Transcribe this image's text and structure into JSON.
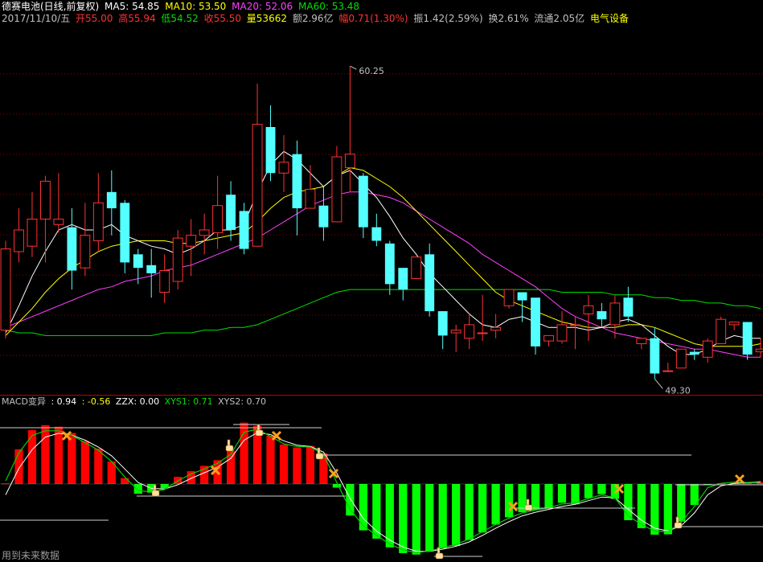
{
  "header": {
    "title": "德赛电池(日线,前复权)",
    "ma5": "MA5: 54.85",
    "ma10": "MA10: 53.50",
    "ma20": "MA20: 52.06",
    "ma60": "MA60: 53.48"
  },
  "quote": {
    "date": "2017/11/10/五",
    "open": "开55.00",
    "high": "高55.94",
    "low": "低54.52",
    "close": "收55.50",
    "volume": "量53662",
    "amount": "额2.96亿",
    "change": "幅0.71(1.30%)",
    "amplitude": "振1.42(2.59%)",
    "turnover": "换2.61%",
    "float": "流通2.05亿",
    "sector": "电气设备"
  },
  "macd_header": {
    "name": "MACD变异",
    "v1": ": 0.94",
    "v2": ": -0.56",
    "zzx": "ZZX: 0.00",
    "xys1": "XYS1: 0.71",
    "xys2": "XYS2: 0.70"
  },
  "footer": "用到未来数据",
  "colors": {
    "up": "#ff3232",
    "down": "#54ffff",
    "ma5": "#ffffff",
    "ma10": "#ffff00",
    "ma20": "#ff40ff",
    "ma60": "#00e000",
    "hist_up": "#ff0000",
    "hist_down": "#00ff00",
    "grid": "#990000"
  },
  "chart_data": [
    {
      "type": "candlestick",
      "high_label": "60.25",
      "low_label": "49.30",
      "ylim": [
        48.5,
        61.8
      ],
      "candles": [
        [
          50.5,
          53.5,
          50.2,
          53.8
        ],
        [
          53.4,
          54.2,
          53.0,
          55.0
        ],
        [
          53.6,
          54.6,
          53.2,
          55.6
        ],
        [
          54.6,
          56.0,
          53.0,
          56.2
        ],
        [
          54.4,
          54.6,
          54.1,
          56.3
        ],
        [
          54.3,
          52.7,
          52.0,
          55.0
        ],
        [
          52.8,
          54.0,
          52.5,
          55.2
        ],
        [
          53.8,
          55.2,
          53.4,
          56.3
        ],
        [
          55.6,
          55.0,
          54.0,
          56.4
        ],
        [
          55.2,
          53.0,
          52.6,
          55.3
        ],
        [
          53.3,
          52.8,
          52.2,
          53.5
        ],
        [
          52.9,
          52.6,
          51.7,
          53.5
        ],
        [
          51.9,
          52.7,
          51.5,
          53.3
        ],
        [
          52.3,
          53.9,
          52.0,
          54.2
        ],
        [
          53.6,
          54.0,
          52.5,
          54.6
        ],
        [
          54.0,
          54.2,
          53.3,
          54.8
        ],
        [
          54.1,
          55.1,
          53.5,
          56.2
        ],
        [
          55.5,
          54.2,
          53.8,
          56.0
        ],
        [
          54.9,
          53.5,
          53.3,
          55.2
        ],
        [
          53.6,
          58.1,
          53.6,
          59.6
        ],
        [
          58.0,
          56.3,
          56.0,
          58.8
        ],
        [
          56.3,
          56.7,
          55.6,
          57.7
        ],
        [
          57.0,
          55.0,
          54.0,
          57.5
        ],
        [
          55.0,
          55.7,
          55.0,
          56.6
        ],
        [
          55.1,
          54.3,
          53.8,
          55.8
        ],
        [
          54.5,
          56.9,
          54.5,
          57.3
        ],
        [
          56.5,
          57.0,
          55.6,
          60.25
        ],
        [
          56.2,
          54.3,
          53.9,
          56.3
        ],
        [
          54.3,
          53.8,
          53.6,
          54.8
        ],
        [
          53.7,
          52.2,
          51.8,
          53.8
        ],
        [
          52.8,
          52.0,
          51.6,
          52.5
        ],
        [
          52.4,
          53.2,
          52.4,
          53.2
        ],
        [
          53.3,
          51.2,
          51.0,
          53.7
        ],
        [
          51.2,
          50.3,
          49.8,
          51.2
        ],
        [
          50.4,
          50.5,
          49.7,
          50.7
        ],
        [
          50.2,
          50.7,
          49.8,
          51.1
        ],
        [
          50.4,
          50.4,
          50.1,
          51.8
        ],
        [
          50.5,
          50.6,
          50.2,
          51.1
        ],
        [
          51.4,
          52.0,
          51.3,
          51.8
        ],
        [
          51.9,
          51.6,
          50.8,
          51.7
        ],
        [
          51.7,
          49.9,
          49.6,
          51.6
        ],
        [
          50.1,
          50.3,
          49.9,
          50.3
        ],
        [
          50.1,
          50.7,
          50.0,
          51.2
        ],
        [
          50.7,
          50.7,
          49.8,
          51.0
        ],
        [
          51.1,
          51.4,
          50.1,
          51.8
        ],
        [
          51.2,
          50.9,
          50.6,
          51.5
        ],
        [
          50.7,
          51.5,
          50.2,
          51.8
        ],
        [
          51.7,
          51.0,
          50.8,
          52.1
        ],
        [
          50.0,
          50.2,
          49.8,
          50.2
        ],
        [
          50.2,
          48.9,
          48.7,
          50.6
        ],
        [
          49.0,
          49.0,
          49.3,
          49.0
        ],
        [
          49.1,
          49.8,
          49.2,
          49.8
        ],
        [
          49.7,
          49.6,
          49.4,
          49.8
        ],
        [
          49.5,
          50.1,
          49.3,
          50.2
        ],
        [
          50.0,
          50.9,
          50.0,
          51.0
        ],
        [
          50.7,
          50.8,
          50.5,
          50.8
        ],
        [
          50.8,
          49.6,
          49.4,
          50.8
        ],
        [
          49.7,
          49.8,
          49.5,
          50.2
        ]
      ],
      "ma5": [
        50.4,
        51.4,
        52.5,
        53.4,
        54.2,
        54.4,
        54.2,
        54.2,
        54.4,
        54.0,
        53.8,
        53.6,
        53.5,
        53.3,
        53.5,
        53.8,
        54.2,
        54.2,
        54.4,
        55.6,
        56.6,
        57.1,
        56.8,
        56.3,
        55.8,
        56.2,
        56.4,
        55.9,
        55.4,
        54.7,
        53.9,
        53.3,
        52.6,
        52.1,
        51.6,
        51.1,
        50.7,
        50.6,
        50.9,
        51.0,
        50.8,
        50.6,
        50.6,
        50.6,
        50.5,
        50.6,
        50.8,
        50.9,
        50.7,
        50.3,
        49.9,
        49.6,
        49.6,
        49.8,
        50.1,
        50.3,
        50.2,
        50.2
      ],
      "ma10": [
        50.3,
        50.8,
        51.3,
        51.9,
        52.4,
        52.8,
        53.1,
        53.4,
        53.6,
        53.7,
        53.8,
        53.8,
        53.8,
        53.7,
        53.7,
        53.8,
        53.9,
        54.0,
        54.1,
        54.5,
        55.0,
        55.4,
        55.6,
        55.7,
        55.8,
        56.2,
        56.5,
        56.4,
        56.1,
        55.8,
        55.4,
        54.9,
        54.4,
        53.9,
        53.4,
        52.9,
        52.4,
        51.9,
        51.6,
        51.4,
        51.2,
        51.0,
        50.8,
        50.7,
        50.6,
        50.6,
        50.6,
        50.7,
        50.7,
        50.6,
        50.4,
        50.2,
        50.0,
        49.9,
        49.9,
        49.9,
        49.9,
        50.0
      ],
      "ma20": [
        50.6,
        50.8,
        51.0,
        51.2,
        51.4,
        51.6,
        51.8,
        52.0,
        52.1,
        52.3,
        52.4,
        52.5,
        52.7,
        52.8,
        52.9,
        53.1,
        53.3,
        53.5,
        53.7,
        53.9,
        54.2,
        54.5,
        54.8,
        55.1,
        55.3,
        55.5,
        55.6,
        55.6,
        55.5,
        55.4,
        55.2,
        54.9,
        54.6,
        54.3,
        54.0,
        53.7,
        53.3,
        53.0,
        52.7,
        52.4,
        52.1,
        51.7,
        51.3,
        51.0,
        50.8,
        50.6,
        50.4,
        50.3,
        50.2,
        50.1,
        50.0,
        49.9,
        49.8,
        49.8,
        49.7,
        49.6,
        49.5,
        49.5
      ],
      "ma60": [
        50.5,
        50.4,
        50.4,
        50.3,
        50.3,
        50.3,
        50.3,
        50.3,
        50.3,
        50.3,
        50.3,
        50.3,
        50.4,
        50.4,
        50.4,
        50.5,
        50.5,
        50.6,
        50.6,
        50.7,
        50.9,
        51.1,
        51.3,
        51.5,
        51.7,
        51.9,
        52.0,
        52.0,
        52.0,
        52.0,
        52.0,
        52.0,
        52.0,
        52.0,
        52.0,
        52.0,
        52.0,
        52.0,
        52.0,
        52.0,
        52.0,
        52.0,
        51.9,
        51.9,
        51.9,
        51.9,
        51.8,
        51.8,
        51.8,
        51.7,
        51.7,
        51.6,
        51.6,
        51.5,
        51.5,
        51.4,
        51.4,
        51.3
      ]
    },
    {
      "type": "bar",
      "title": "MACD变异",
      "ylim": [
        -2.0,
        1.9
      ],
      "values": [
        0.02,
        1.11,
        1.72,
        1.88,
        1.83,
        1.63,
        1.37,
        1.13,
        0.72,
        0.19,
        -0.27,
        -0.24,
        -0.12,
        0.23,
        0.41,
        0.58,
        0.76,
        1.06,
        1.96,
        1.86,
        1.54,
        1.26,
        1.17,
        1.22,
        0.98,
        -0.1,
        -0.87,
        -1.28,
        -1.51,
        -1.75,
        -1.91,
        -1.95,
        -1.86,
        -1.78,
        -1.71,
        -1.55,
        -1.34,
        -1.12,
        -0.92,
        -0.78,
        -0.72,
        -0.66,
        -0.52,
        -0.56,
        -0.39,
        -0.28,
        -0.41,
        -1.0,
        -1.22,
        -1.4,
        -1.39,
        -1.04,
        -0.58,
        -0.02,
        0.03,
        0.05,
        0.04,
        0.06
      ],
      "dif": [
        0.1,
        1.0,
        1.55,
        1.7,
        1.7,
        1.55,
        1.32,
        1.08,
        0.72,
        0.22,
        -0.18,
        -0.22,
        -0.15,
        0.1,
        0.32,
        0.48,
        0.66,
        0.95,
        1.65,
        1.75,
        1.52,
        1.28,
        1.2,
        1.18,
        0.95,
        0.05,
        -0.7,
        -1.15,
        -1.42,
        -1.66,
        -1.82,
        -1.9,
        -1.85,
        -1.76,
        -1.67,
        -1.52,
        -1.32,
        -1.12,
        -0.94,
        -0.8,
        -0.72,
        -0.66,
        -0.55,
        -0.52,
        -0.4,
        -0.3,
        -0.38,
        -0.88,
        -1.12,
        -1.3,
        -1.32,
        -1.05,
        -0.62,
        -0.1,
        0.02,
        0.06,
        0.05,
        0.08
      ],
      "dea": [
        -0.3,
        0.5,
        1.1,
        1.5,
        1.62,
        1.56,
        1.4,
        1.18,
        0.9,
        0.48,
        0.05,
        -0.12,
        -0.14,
        -0.02,
        0.18,
        0.36,
        0.54,
        0.82,
        1.4,
        1.64,
        1.58,
        1.38,
        1.24,
        1.2,
        1.02,
        0.35,
        -0.4,
        -0.95,
        -1.3,
        -1.55,
        -1.74,
        -1.86,
        -1.86,
        -1.8,
        -1.72,
        -1.6,
        -1.42,
        -1.22,
        -1.04,
        -0.88,
        -0.78,
        -0.7,
        -0.62,
        -0.56,
        -0.46,
        -0.36,
        -0.38,
        -0.7,
        -1.0,
        -1.22,
        -1.3,
        -1.15,
        -0.8,
        -0.3,
        -0.05,
        0.02,
        0.04,
        0.06
      ]
    }
  ]
}
